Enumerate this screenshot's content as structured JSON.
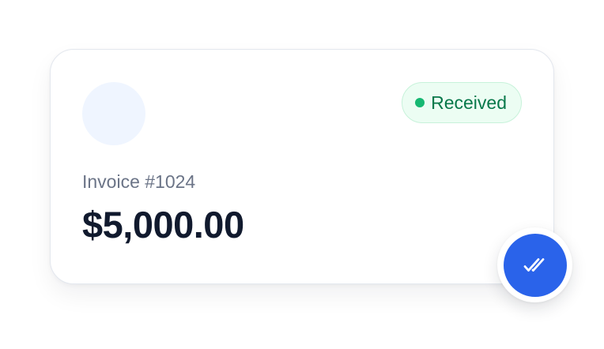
{
  "invoice": {
    "status_label": "Received",
    "number_label": "Invoice #1024",
    "amount": "$5,000.00"
  },
  "icons": {
    "status_dot": "dot-icon",
    "fab": "double-check-icon"
  },
  "colors": {
    "status_text": "#07784a",
    "status_dot": "#16b872",
    "status_bg": "#ecfdf3",
    "accent": "#2a63ea",
    "amount_text": "#111a2e",
    "muted_text": "#6b7487",
    "avatar_bg": "#eff5ff"
  }
}
